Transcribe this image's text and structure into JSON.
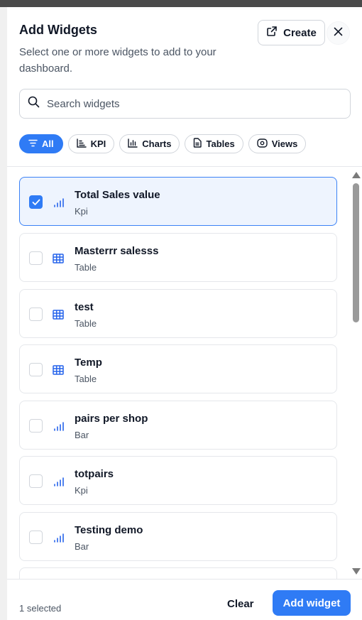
{
  "header": {
    "title": "Add Widgets",
    "subtitle": "Select one or more widgets to add to your dashboard.",
    "create_label": "Create"
  },
  "search": {
    "placeholder": "Search widgets",
    "value": ""
  },
  "filters": [
    {
      "label": "All",
      "icon": "filter-icon",
      "active": true
    },
    {
      "label": "KPI",
      "icon": "kpi-icon",
      "active": false
    },
    {
      "label": "Charts",
      "icon": "bar-chart-icon",
      "active": false
    },
    {
      "label": "Tables",
      "icon": "document-icon",
      "active": false
    },
    {
      "label": "Views",
      "icon": "eye-icon",
      "active": false
    }
  ],
  "widgets": [
    {
      "name": "Total Sales value",
      "type": "Kpi",
      "icon": "signal-bars-icon",
      "selected": true
    },
    {
      "name": "Masterrr salesss",
      "type": "Table",
      "icon": "table-grid-icon",
      "selected": false
    },
    {
      "name": "test",
      "type": "Table",
      "icon": "table-grid-icon",
      "selected": false
    },
    {
      "name": "Temp",
      "type": "Table",
      "icon": "table-grid-icon",
      "selected": false
    },
    {
      "name": "pairs per shop",
      "type": "Bar",
      "icon": "signal-bars-icon",
      "selected": false
    },
    {
      "name": "totpairs",
      "type": "Kpi",
      "icon": "signal-bars-icon",
      "selected": false
    },
    {
      "name": "Testing demo",
      "type": "Bar",
      "icon": "signal-bars-icon",
      "selected": false
    }
  ],
  "footer": {
    "selected_text": "1 selected",
    "clear_label": "Clear",
    "add_label": "Add widget"
  },
  "colors": {
    "accent": "#2f7bf5",
    "selected_bg": "#eef4fe",
    "icon_blue": "#2563eb"
  }
}
